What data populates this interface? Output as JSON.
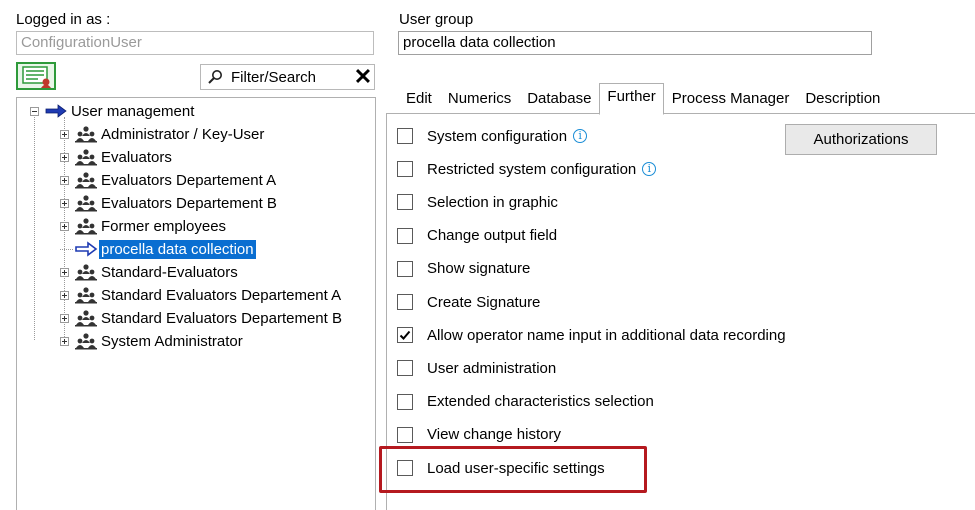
{
  "logged_in": {
    "label": "Logged in as :",
    "value": "ConfigurationUser"
  },
  "user_group": {
    "label": "User group",
    "value": "procella data collection"
  },
  "filter": {
    "label": "Filter/Search",
    "clear_glyph": "✕"
  },
  "tree": {
    "root": "User management",
    "items": [
      {
        "label": "Administrator / Key-User",
        "icon": "user-group-icon",
        "selected": false
      },
      {
        "label": "Evaluators",
        "icon": "user-group-icon",
        "selected": false
      },
      {
        "label": "Evaluators Departement A",
        "icon": "user-group-icon",
        "selected": false
      },
      {
        "label": "Evaluators Departement B",
        "icon": "user-group-icon",
        "selected": false
      },
      {
        "label": "Former employees",
        "icon": "user-group-icon",
        "selected": false
      },
      {
        "label": "procella data collection",
        "icon": "arrow-right-icon",
        "selected": true
      },
      {
        "label": "Standard-Evaluators",
        "icon": "user-group-icon",
        "selected": false
      },
      {
        "label": "Standard Evaluators Departement A",
        "icon": "user-group-icon",
        "selected": false
      },
      {
        "label": "Standard Evaluators Departement B",
        "icon": "user-group-icon",
        "selected": false
      },
      {
        "label": "System Administrator",
        "icon": "user-group-icon",
        "selected": false
      }
    ]
  },
  "tabs": [
    {
      "label": "Edit",
      "active": false
    },
    {
      "label": "Numerics",
      "active": false
    },
    {
      "label": "Database",
      "active": false
    },
    {
      "label": "Further",
      "active": true
    },
    {
      "label": "Process Manager",
      "active": false
    },
    {
      "label": "Description",
      "active": false
    }
  ],
  "authorizations_button": "Authorizations",
  "options": [
    {
      "label": "System configuration",
      "checked": false,
      "info": true
    },
    {
      "label": "Restricted system configuration",
      "checked": false,
      "info": true
    },
    {
      "label": "Selection in graphic",
      "checked": false,
      "info": false
    },
    {
      "label": "Change output field",
      "checked": false,
      "info": false
    },
    {
      "label": "Show signature",
      "checked": false,
      "info": false
    },
    {
      "label": "Create Signature",
      "checked": false,
      "info": false
    },
    {
      "label": "Allow operator name input in additional data recording",
      "checked": true,
      "info": false
    },
    {
      "label": "User administration",
      "checked": false,
      "info": false
    },
    {
      "label": "Extended characteristics selection",
      "checked": false,
      "info": false
    },
    {
      "label": "View change history",
      "checked": false,
      "info": false
    },
    {
      "label": "Load user-specific settings",
      "checked": false,
      "info": false
    }
  ],
  "info_glyph": "i",
  "colors": {
    "selection": "#0a6ed1",
    "highlight_box": "#b5191f",
    "tool_button_border": "#2e9a3a",
    "info_icon": "#1a8dd6"
  }
}
